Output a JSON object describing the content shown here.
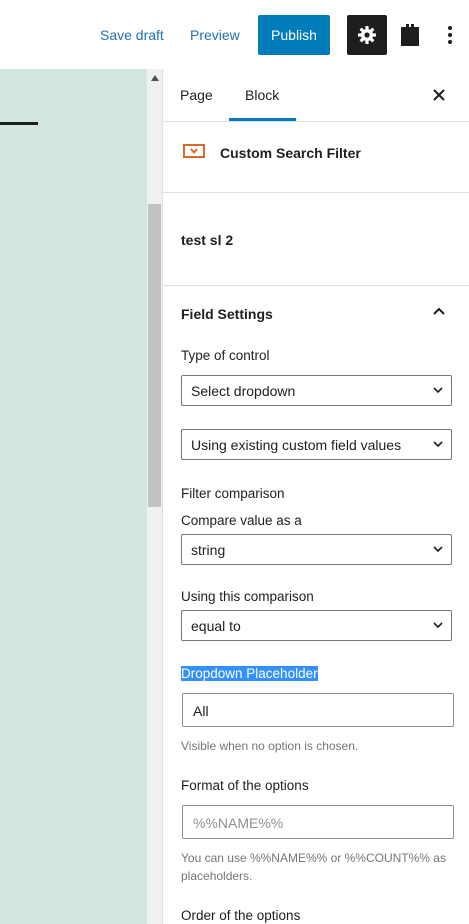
{
  "toolbar": {
    "save_draft": "Save draft",
    "preview": "Preview",
    "publish": "Publish"
  },
  "sidebar": {
    "tabs": [
      "Page",
      "Block"
    ],
    "active_tab": "Block",
    "block_name": "Custom Search Filter",
    "block_title": "test sl 2",
    "panel_title": "Field Settings",
    "type_of_control_label": "Type of control",
    "type_of_control_value": "Select dropdown",
    "source_value": "Using existing custom field values",
    "filter_comparison_label": "Filter comparison",
    "compare_as_label": "Compare value as a",
    "compare_as_value": "string",
    "comparison_label": "Using this comparison",
    "comparison_value": "equal to",
    "placeholder_label": "Dropdown Placeholder",
    "placeholder_value": "All",
    "placeholder_help": "Visible when no option is chosen.",
    "format_label": "Format of the options",
    "format_placeholder": "%%NAME%%",
    "format_help": "You can use %%NAME%% or %%COUNT%% as placeholders.",
    "order_label": "Order of the options"
  },
  "colors": {
    "accent": "#007cba",
    "canvas": "#d3e5df",
    "selection": "#3390ff"
  }
}
